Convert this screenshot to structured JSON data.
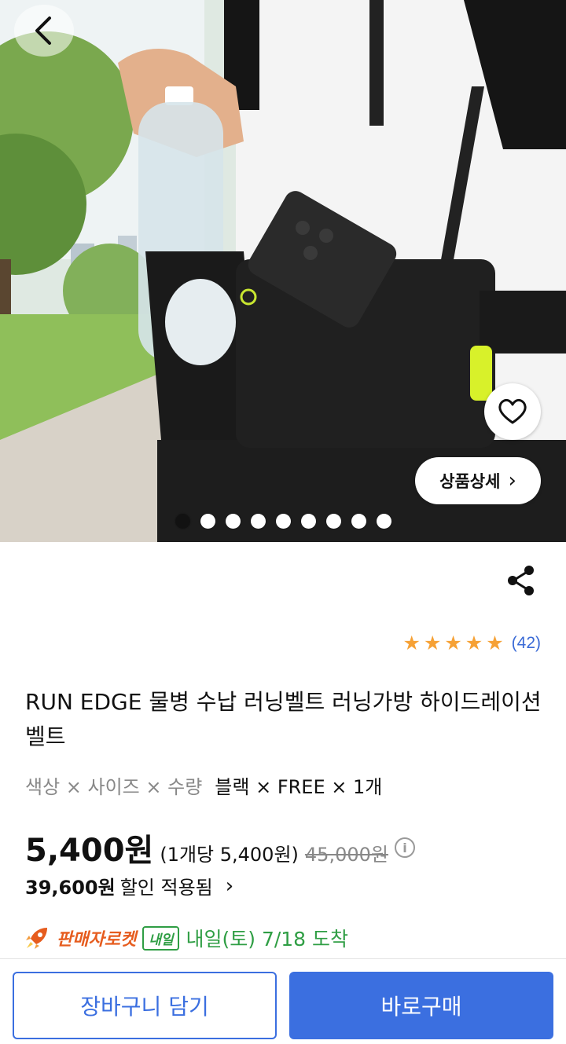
{
  "hero": {
    "detail_label": "상품상세",
    "detail_chevron": "›",
    "slide_count": 9,
    "active_slide": 1
  },
  "product": {
    "rating": 5,
    "review_count": "(42)",
    "title": "RUN EDGE 물병 수납 러닝벨트 러닝가방 하이드레이션 벨트",
    "option_label": "색상 × 사이즈 × 수량",
    "option_value": "블랙 × FREE × 1개",
    "price": "5,400원",
    "unit_price": "(1개당 5,400원)",
    "original_price": "45,000원",
    "info_icon": "i",
    "discount_amount": "39,600원",
    "discount_text": "할인 적용됨",
    "discount_chevron": "›"
  },
  "delivery": {
    "rocket_label": "판매자로켓",
    "badge": "내일",
    "text": "내일(토) 7/18 도착"
  },
  "buttons": {
    "cart": "장바구니 담기",
    "buy": "바로구매"
  },
  "colors": {
    "accent_blue": "#3b6fe0",
    "star": "#f6a135",
    "delivery_green": "#2f9e44",
    "rocket_orange": "#e65c1e"
  },
  "icons": [
    "back-arrow-icon",
    "heart-icon",
    "share-icon",
    "star-icon",
    "info-icon",
    "rocket-icon",
    "chevron-right-icon"
  ]
}
